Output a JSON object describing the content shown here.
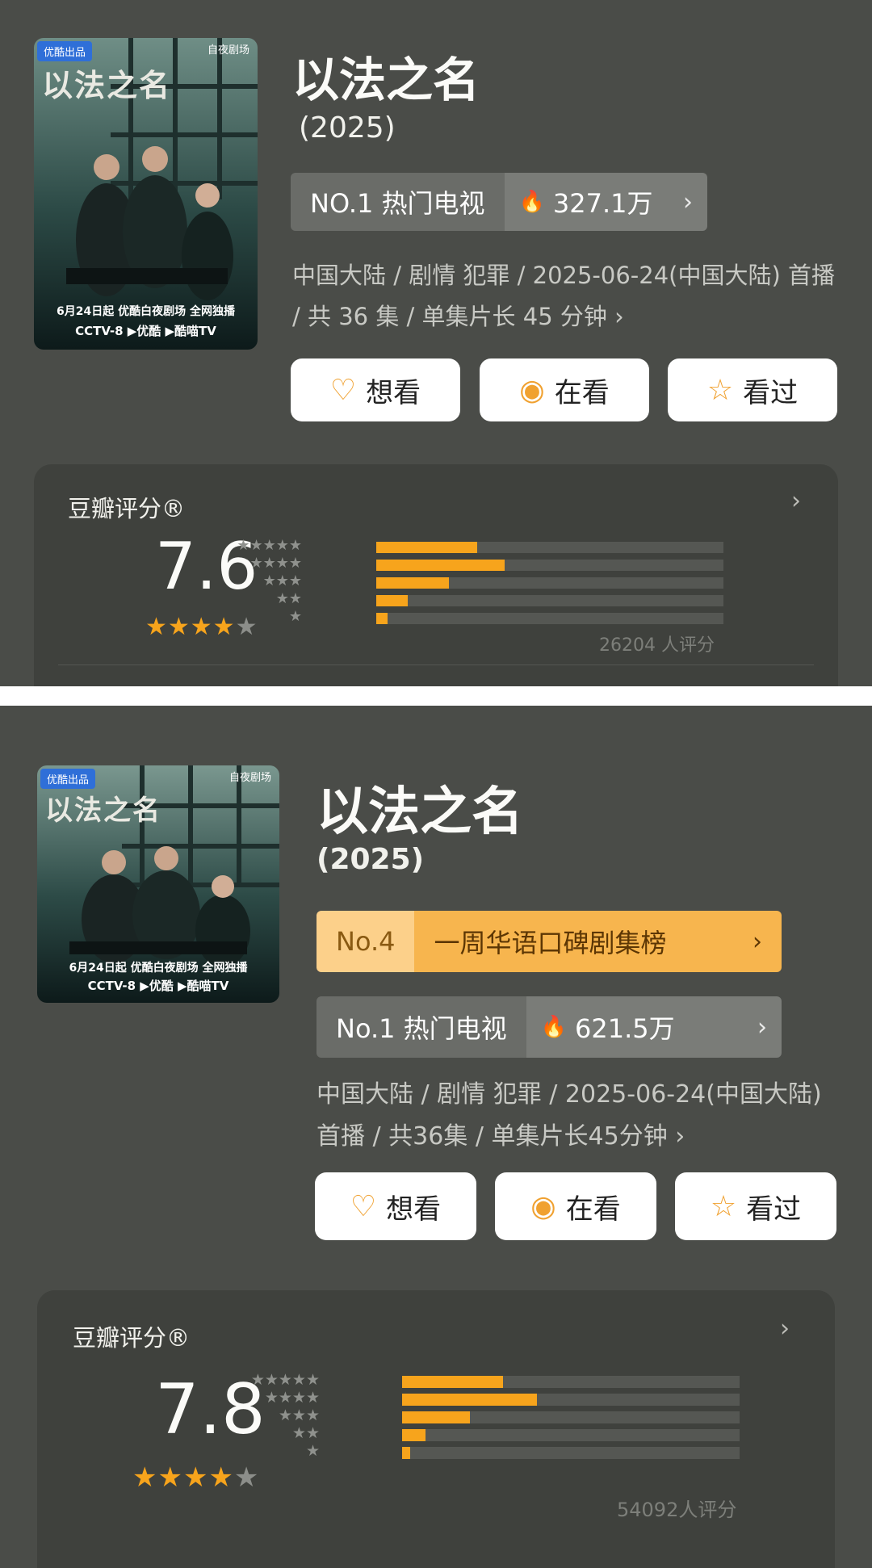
{
  "panel1": {
    "poster": {
      "badge": "优酷出品",
      "logo": "自夜剧场",
      "art_title": "以法之名",
      "tagline": "6月24日起 优酷白夜剧场 全网独播",
      "platforms": "CCTV-8 ▶优酷 ▶酷喵TV"
    },
    "title": "以法之名",
    "year": "(2025)",
    "ranks": [
      {
        "label": "NO.1 热门电视",
        "value": "327.1万",
        "icon": "flame-icon"
      }
    ],
    "meta": "中国大陆 / 剧情 犯罪 / 2025-06-24(中国大陆) 首播 / 共 36 集 / 单集片长 45 分钟 ›",
    "buttons": [
      {
        "label": "想看",
        "icon": "heart-plus-icon",
        "glyph": "♡"
      },
      {
        "label": "在看",
        "icon": "target-icon",
        "glyph": "◉"
      },
      {
        "label": "看过",
        "icon": "star-icon",
        "glyph": "☆"
      }
    ],
    "rating": {
      "label": "豆瓣评分®",
      "score": "7.6",
      "stars_filled": 4,
      "distribution": [
        {
          "stars": 5,
          "fraction": 0.29
        },
        {
          "stars": 4,
          "fraction": 0.37
        },
        {
          "stars": 3,
          "fraction": 0.21
        },
        {
          "stars": 2,
          "fraction": 0.09
        },
        {
          "stars": 1,
          "fraction": 0.03
        }
      ],
      "count": "26204 人评分"
    }
  },
  "panel2": {
    "poster": {
      "badge": "优酷出品",
      "logo": "自夜剧场",
      "art_title": "以法之名",
      "tagline": "6月24日起 优酷白夜剧场 全网独播",
      "platforms": "CCTV-8 ▶优酷 ▶酷喵TV"
    },
    "title": "以法之名",
    "year": "(2025)",
    "orange_rank": {
      "no": "No.4",
      "label": "一周华语口碑剧集榜"
    },
    "ranks": [
      {
        "label": "No.1 热门电视",
        "value": "621.5万",
        "icon": "flame-icon"
      }
    ],
    "meta": "中国大陆 / 剧情 犯罪 / 2025-06-24(中国大陆)首播 / 共36集 / 单集片长45分钟 ›",
    "buttons": [
      {
        "label": "想看",
        "icon": "heart-plus-icon",
        "glyph": "♡"
      },
      {
        "label": "在看",
        "icon": "target-icon",
        "glyph": "◉"
      },
      {
        "label": "看过",
        "icon": "star-icon",
        "glyph": "☆"
      }
    ],
    "rating": {
      "label": "豆瓣评分®",
      "score": "7.8",
      "stars_filled": 4,
      "distribution": [
        {
          "stars": 5,
          "fraction": 0.3
        },
        {
          "stars": 4,
          "fraction": 0.4
        },
        {
          "stars": 3,
          "fraction": 0.2
        },
        {
          "stars": 2,
          "fraction": 0.07
        },
        {
          "stars": 1,
          "fraction": 0.02
        }
      ],
      "count": "54092人评分"
    }
  }
}
